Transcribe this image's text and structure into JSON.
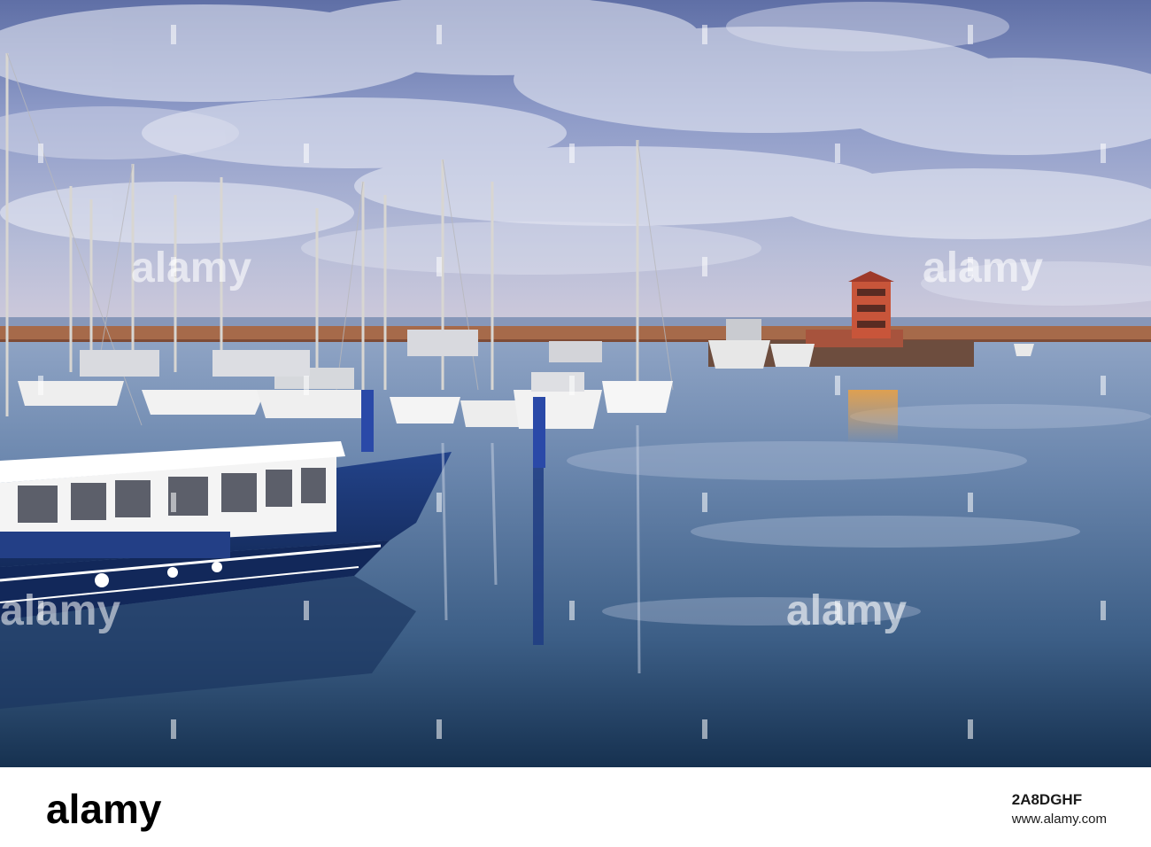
{
  "watermark": {
    "text": "alamy",
    "color": "#ffffff"
  },
  "footer": {
    "logo_text": "alamy",
    "image_id": "2A8DGHF",
    "site": "www.alamy.com",
    "background": "#ffffff"
  },
  "scene": {
    "sky_colors": [
      "#6f7fb4",
      "#9aa8d0",
      "#c9c7d6"
    ],
    "water_colors": [
      "#7c92b6",
      "#3e5f86",
      "#16324f"
    ],
    "tower_color": "#c8553a",
    "boat_hull_color": "#1d3a7a"
  }
}
